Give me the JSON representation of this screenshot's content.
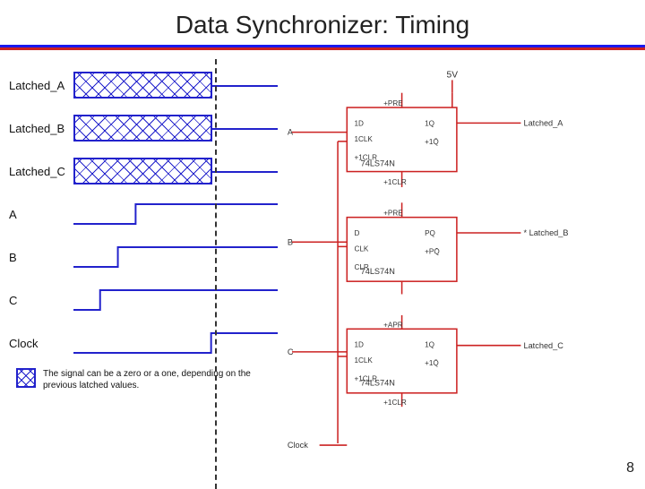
{
  "title": "Data Synchronizer: Timing",
  "signals": [
    {
      "label": "Latched_A",
      "type": "latched"
    },
    {
      "label": "Latched_B",
      "type": "latched"
    },
    {
      "label": "Latched_C",
      "type": "latched"
    },
    {
      "label": "A",
      "type": "digital_a"
    },
    {
      "label": "B",
      "type": "digital_b"
    },
    {
      "label": "C",
      "type": "digital_c"
    },
    {
      "label": "Clock",
      "type": "clock"
    }
  ],
  "footnote": {
    "text": "The signal can be a zero or a one, depending on the previous latched values."
  },
  "page_number": "8",
  "circuit": {
    "labels": [
      "A",
      "B",
      "C",
      "Clock",
      "Latched_A",
      "Latched_B",
      "Latched_C"
    ],
    "chips": [
      "74LS74N",
      "74LS74N",
      "74LS74N"
    ],
    "voltage": "5V"
  }
}
